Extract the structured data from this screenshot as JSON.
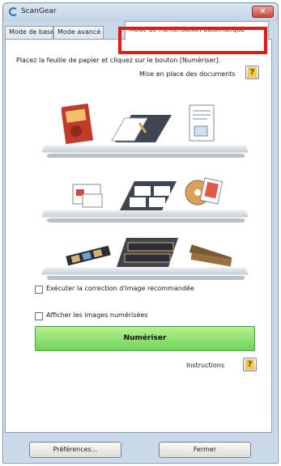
{
  "window": {
    "title": "ScanGear",
    "close_glyph": "✕"
  },
  "tabs": [
    {
      "label": "Mode de base"
    },
    {
      "label": "Mode avancé"
    },
    {
      "label": "Mode de numérisation automatique"
    }
  ],
  "instruction": "Placez la feuille de papier et cliquez sur le bouton [Numériser].",
  "doc_placement_link": "Mise en place des documents",
  "help_glyph": "?",
  "checkboxes": [
    {
      "label": "Exécuter la correction d'image recommandée",
      "checked": false
    },
    {
      "label": "Afficher les images numérisées",
      "checked": false
    }
  ],
  "scan_button": "Numériser",
  "instructions_label": "Instructions",
  "bottom": {
    "prefs_label": "Préférences...",
    "close_label": "Fermer"
  },
  "colors": {
    "highlight": "#e0191a",
    "scan_button": "#7ed463"
  }
}
